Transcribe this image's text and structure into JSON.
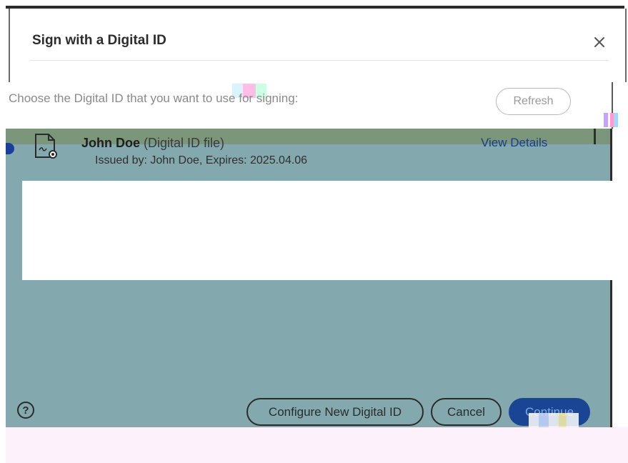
{
  "dialog": {
    "title": "Sign with a Digital ID",
    "prompt": "Choose the Digital ID that you want to use for signing:",
    "refresh_label": "Refresh"
  },
  "digital_id": {
    "name": "John Doe",
    "type": "(Digital ID file)",
    "issued": "Issued by: John Doe, Expires: 2025.04.06",
    "view_details_label": "View Details",
    "icon": "certificate-file-icon"
  },
  "footer": {
    "help_label": "?",
    "configure_label": "Configure New Digital ID",
    "cancel_label": "Cancel",
    "continue_label": "Continue"
  },
  "colors": {
    "accent": "#1a4595",
    "content_bg": "#83a9ae",
    "link": "#163e8a"
  }
}
